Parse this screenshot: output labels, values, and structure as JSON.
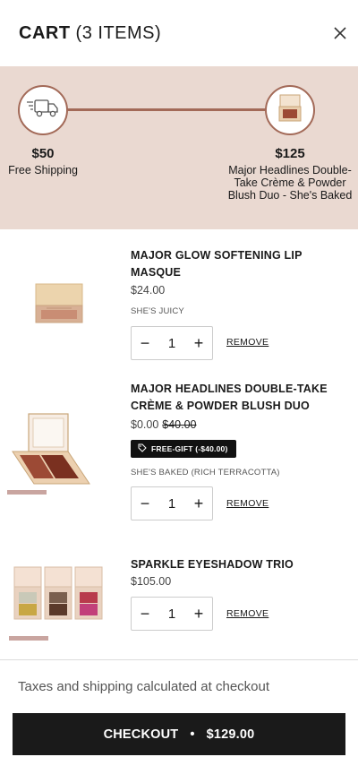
{
  "header": {
    "title": "CART",
    "item_count": "(3 ITEMS)",
    "close_icon": "close-icon"
  },
  "progress": {
    "colors": {
      "band": "#ead9d1",
      "accent": "#a36a58"
    },
    "tiers": [
      {
        "amount": "$50",
        "label": "Free Shipping",
        "icon": "truck-icon"
      },
      {
        "amount": "$125",
        "label": "Major Headlines Double-Take Crème & Powder Blush Duo - She's Baked",
        "icon": "blush-compact-icon"
      }
    ]
  },
  "items": [
    {
      "name": "MAJOR GLOW SOFTENING LIP MASQUE",
      "price": "$24.00",
      "variant": "SHE'S JUICY",
      "quantity": "1",
      "remove_label": "REMOVE",
      "minus": "−",
      "plus": "+"
    },
    {
      "name": "MAJOR HEADLINES DOUBLE-TAKE CRÈME & POWDER BLUSH DUO",
      "price": "$0.00",
      "original_price": "$40.00",
      "gift_badge": "FREE-GIFT (-$40.00)",
      "variant": "SHE'S BAKED (RICH TERRACOTTA)",
      "quantity": "1",
      "remove_label": "REMOVE",
      "minus": "−",
      "plus": "+"
    },
    {
      "name": "SPARKLE EYESHADOW TRIO",
      "price": "$105.00",
      "quantity": "1",
      "remove_label": "REMOVE",
      "minus": "−",
      "plus": "+"
    }
  ],
  "footer": {
    "taxes_note": "Taxes and shipping calculated at checkout",
    "checkout_label": "CHECKOUT",
    "separator": "•",
    "total": "$129.00"
  }
}
